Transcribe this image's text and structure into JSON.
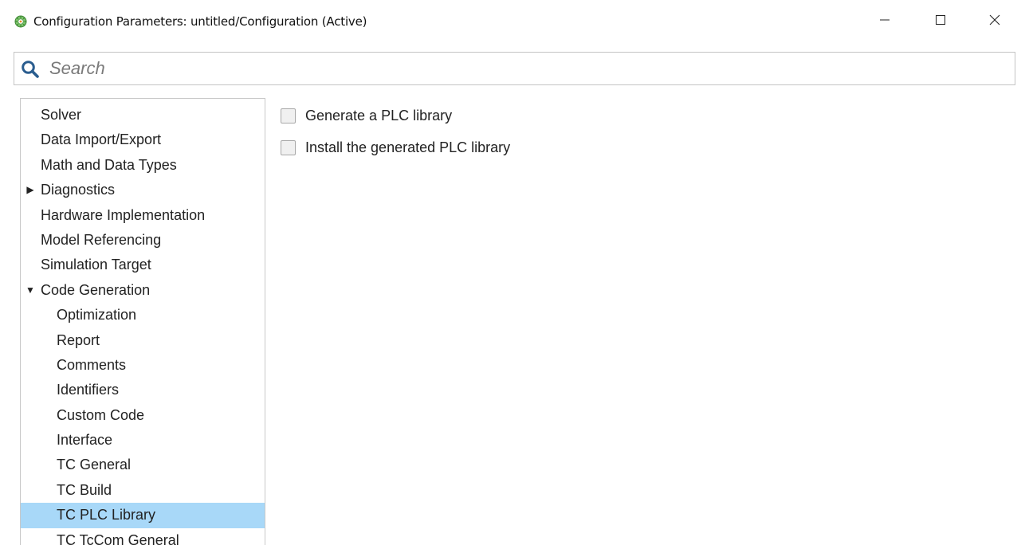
{
  "window": {
    "title": "Configuration Parameters: untitled/Configuration (Active)",
    "icon": "simulink-gear-icon",
    "controls": {
      "minimize": "minimize-icon",
      "maximize": "maximize-icon",
      "close": "close-icon"
    }
  },
  "search": {
    "placeholder": "Search",
    "value": "",
    "icon": "search-icon"
  },
  "tree": {
    "items": [
      {
        "label": "Solver",
        "level": 0,
        "expander": ""
      },
      {
        "label": "Data Import/Export",
        "level": 0,
        "expander": ""
      },
      {
        "label": "Math and Data Types",
        "level": 0,
        "expander": ""
      },
      {
        "label": "Diagnostics",
        "level": 0,
        "expander": "collapsed"
      },
      {
        "label": "Hardware Implementation",
        "level": 0,
        "expander": ""
      },
      {
        "label": "Model Referencing",
        "level": 0,
        "expander": ""
      },
      {
        "label": "Simulation Target",
        "level": 0,
        "expander": ""
      },
      {
        "label": "Code Generation",
        "level": 0,
        "expander": "expanded"
      },
      {
        "label": "Optimization",
        "level": 1,
        "expander": ""
      },
      {
        "label": "Report",
        "level": 1,
        "expander": ""
      },
      {
        "label": "Comments",
        "level": 1,
        "expander": ""
      },
      {
        "label": "Identifiers",
        "level": 1,
        "expander": ""
      },
      {
        "label": "Custom Code",
        "level": 1,
        "expander": ""
      },
      {
        "label": "Interface",
        "level": 1,
        "expander": ""
      },
      {
        "label": "TC General",
        "level": 1,
        "expander": ""
      },
      {
        "label": "TC Build",
        "level": 1,
        "expander": ""
      },
      {
        "label": "TC PLC Library",
        "level": 1,
        "expander": "",
        "selected": true
      },
      {
        "label": "TC TcCom General",
        "level": 1,
        "expander": ""
      }
    ],
    "selected_color": "#a8d8f8"
  },
  "content": {
    "options": [
      {
        "label": "Generate a PLC library",
        "checked": false
      },
      {
        "label": "Install the generated PLC library",
        "checked": false
      }
    ]
  }
}
